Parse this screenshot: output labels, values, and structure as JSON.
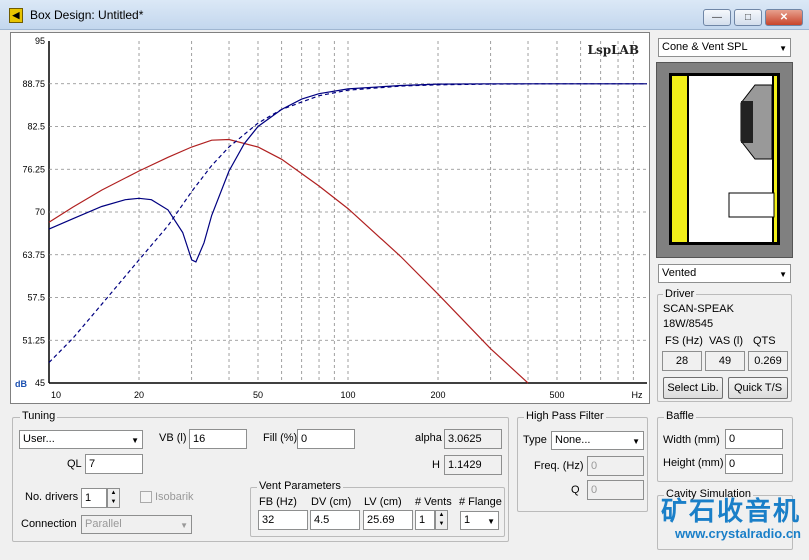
{
  "window": {
    "title": "Box Design: Untitled*",
    "icon": "speaker-icon",
    "minimize": "—",
    "maximize": "□",
    "close": "✕"
  },
  "graph": {
    "logo": "LspLAB",
    "y_unit": "dB",
    "y_ticks": [
      "95",
      "88.75",
      "82.5",
      "76.25",
      "70",
      "63.75",
      "57.5",
      "51.25",
      "45"
    ],
    "x_ticks": [
      "10",
      "20",
      "50",
      "100",
      "200",
      "500",
      "Hz"
    ]
  },
  "chart_data": {
    "type": "line",
    "x_scale": "log",
    "xlim": [
      10,
      1000
    ],
    "ylim": [
      45,
      95
    ],
    "ylabel": "dB",
    "xlabel": "Hz",
    "grid": true,
    "series": [
      {
        "color": "#b02020",
        "style": "solid",
        "x": [
          10,
          12,
          15,
          20,
          25,
          30,
          35,
          40,
          50,
          60,
          80,
          100,
          150,
          200,
          300,
          400
        ],
        "y": [
          68.5,
          70.7,
          73.2,
          76,
          78,
          79.5,
          80.5,
          80.6,
          79.5,
          77.7,
          73.8,
          70.5,
          63.5,
          58,
          50,
          45
        ]
      },
      {
        "color": "#000080",
        "style": "solid",
        "x": [
          10,
          12,
          15,
          18,
          20,
          22,
          25,
          28,
          30,
          31,
          33,
          35,
          40,
          45,
          50,
          60,
          70,
          80,
          100,
          150,
          200,
          300,
          500,
          1000
        ],
        "y": [
          67.5,
          69,
          70.8,
          71.8,
          72,
          71.8,
          70.3,
          67,
          63,
          62.7,
          65.5,
          69.5,
          76,
          80,
          82.5,
          85,
          86.5,
          87.3,
          88,
          88.5,
          88.7,
          88.75,
          88.75,
          88.75
        ]
      },
      {
        "color": "#000080",
        "style": "dashed",
        "x": [
          10,
          12,
          15,
          20,
          25,
          30,
          35,
          40,
          50,
          60,
          80,
          100,
          150,
          200,
          300,
          500,
          1000
        ],
        "y": [
          48,
          51.5,
          56.5,
          63,
          68,
          73,
          76.8,
          79.5,
          83,
          85,
          87,
          87.8,
          88.4,
          88.6,
          88.7,
          88.75,
          88.75
        ]
      }
    ]
  },
  "right": {
    "graph_select": "Cone & Vent SPL",
    "box_type": "Vented",
    "driver_legend": "Driver",
    "driver_name": "SCAN-SPEAK",
    "driver_model": "18W/8545",
    "fs_label": "FS (Hz)",
    "vas_label": "VAS (l)",
    "qts_label": "QTS",
    "fs": "28",
    "vas": "49",
    "qts": "0.269",
    "select_lib": "Select Lib.",
    "quick_ts": "Quick T/S"
  },
  "tuning": {
    "legend": "Tuning",
    "preset": "User...",
    "vb_label": "VB (l)",
    "vb": "16",
    "fill_label": "Fill (%)",
    "fill": "0",
    "alpha_label": "alpha",
    "alpha": "3.0625",
    "ql_label": "QL",
    "ql": "7",
    "h_label": "H",
    "h": "1.1429",
    "drivers_label": "No. drivers",
    "drivers": "1",
    "isobarik_label": "Isobarik",
    "connection_label": "Connection",
    "connection": "Parallel"
  },
  "vent": {
    "legend": "Vent Parameters",
    "fb_label": "FB (Hz)",
    "fb": "32",
    "dv_label": "DV (cm)",
    "dv": "4.5",
    "lv_label": "LV (cm)",
    "lv": "25.69",
    "nvents_label": "# Vents",
    "nvents": "1",
    "flange_label": "# Flange",
    "flange": "1"
  },
  "hpf": {
    "legend": "High Pass Filter",
    "type_label": "Type",
    "type": "None...",
    "freq_label": "Freq. (Hz)",
    "freq": "0",
    "q_label": "Q",
    "q": "0"
  },
  "baffle": {
    "legend": "Baffle",
    "width_label": "Width (mm)",
    "width": "0",
    "height_label": "Height (mm)",
    "height": "0"
  },
  "cavity": {
    "legend": "Cavity Simulation"
  },
  "watermark": {
    "cn": "矿石收音机",
    "url": "www.crystalradio.cn"
  }
}
